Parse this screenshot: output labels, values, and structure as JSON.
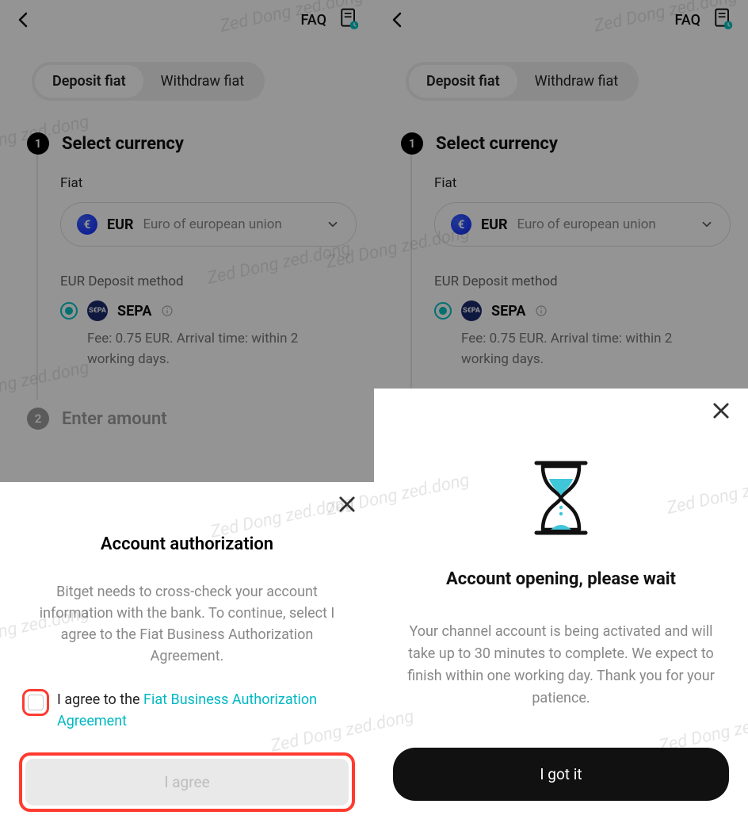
{
  "header": {
    "faq": "FAQ"
  },
  "tabs": {
    "deposit": "Deposit fiat",
    "withdraw": "Withdraw fiat"
  },
  "step1": {
    "num": "1",
    "title": "Select currency",
    "fiat_label": "Fiat",
    "currency_code": "EUR",
    "currency_name": "Euro of european union",
    "method_label": "EUR Deposit method",
    "method_name": "SEPA",
    "sepa_badge": "S€PA",
    "fee_text": "Fee: 0.75 EUR. Arrival time: within 2 working days."
  },
  "step2": {
    "num": "2",
    "title": "Enter amount"
  },
  "sheet_left": {
    "title": "Account authorization",
    "body": "Bitget needs to cross-check your account information with the bank. To continue, select I agree to the Fiat Business Authorization Agreement.",
    "agree_prefix": "I agree to the ",
    "agree_link": "Fiat Business Authorization Agreement",
    "button": "I agree"
  },
  "sheet_right": {
    "title": "Account opening, please wait",
    "body": "Your channel account is being activated and will take up to 30 minutes to complete. We expect to finish within one working day. Thank you for your patience.",
    "button": "I got it"
  },
  "watermark": "Zed Dong zed.dong"
}
